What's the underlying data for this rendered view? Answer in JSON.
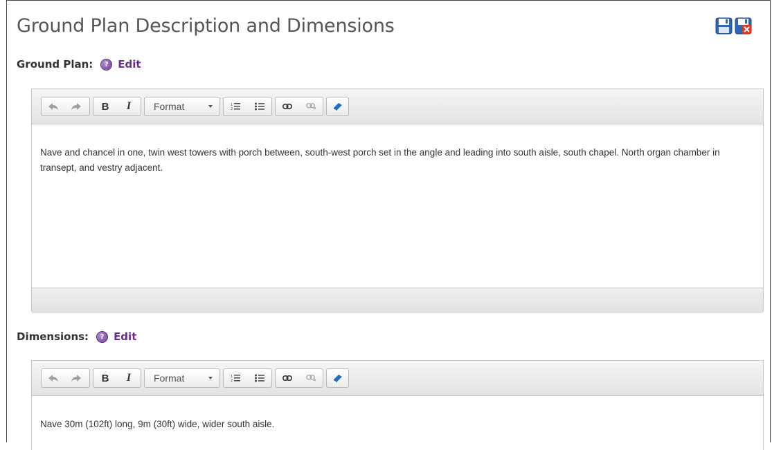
{
  "page": {
    "title": "Ground Plan Description and Dimensions"
  },
  "header_icons": [
    "save-icon",
    "save-close-icon"
  ],
  "toolbar": {
    "format_label": "Format",
    "buttons": [
      "undo-icon",
      "redo-icon",
      "bold-icon",
      "italic-icon",
      "format-dropdown",
      "numbered-list-icon",
      "bulleted-list-icon",
      "link-icon",
      "unlink-icon",
      "glossary-book-icon"
    ],
    "bold_label": "B",
    "italic_label": "I"
  },
  "sections": {
    "ground_plan": {
      "label": "Ground Plan:",
      "help_glyph": "?",
      "edit_label": "Edit",
      "content": "Nave and chancel in one, twin west towers with porch between, south-west porch set in the angle and leading into south aisle, south chapel. North organ chamber in transept, and vestry adjacent."
    },
    "dimensions": {
      "label": "Dimensions:",
      "help_glyph": "?",
      "edit_label": "Edit",
      "content": "Nave 30m (102ft) long, 9m (30ft) wide, wider south aisle."
    }
  }
}
